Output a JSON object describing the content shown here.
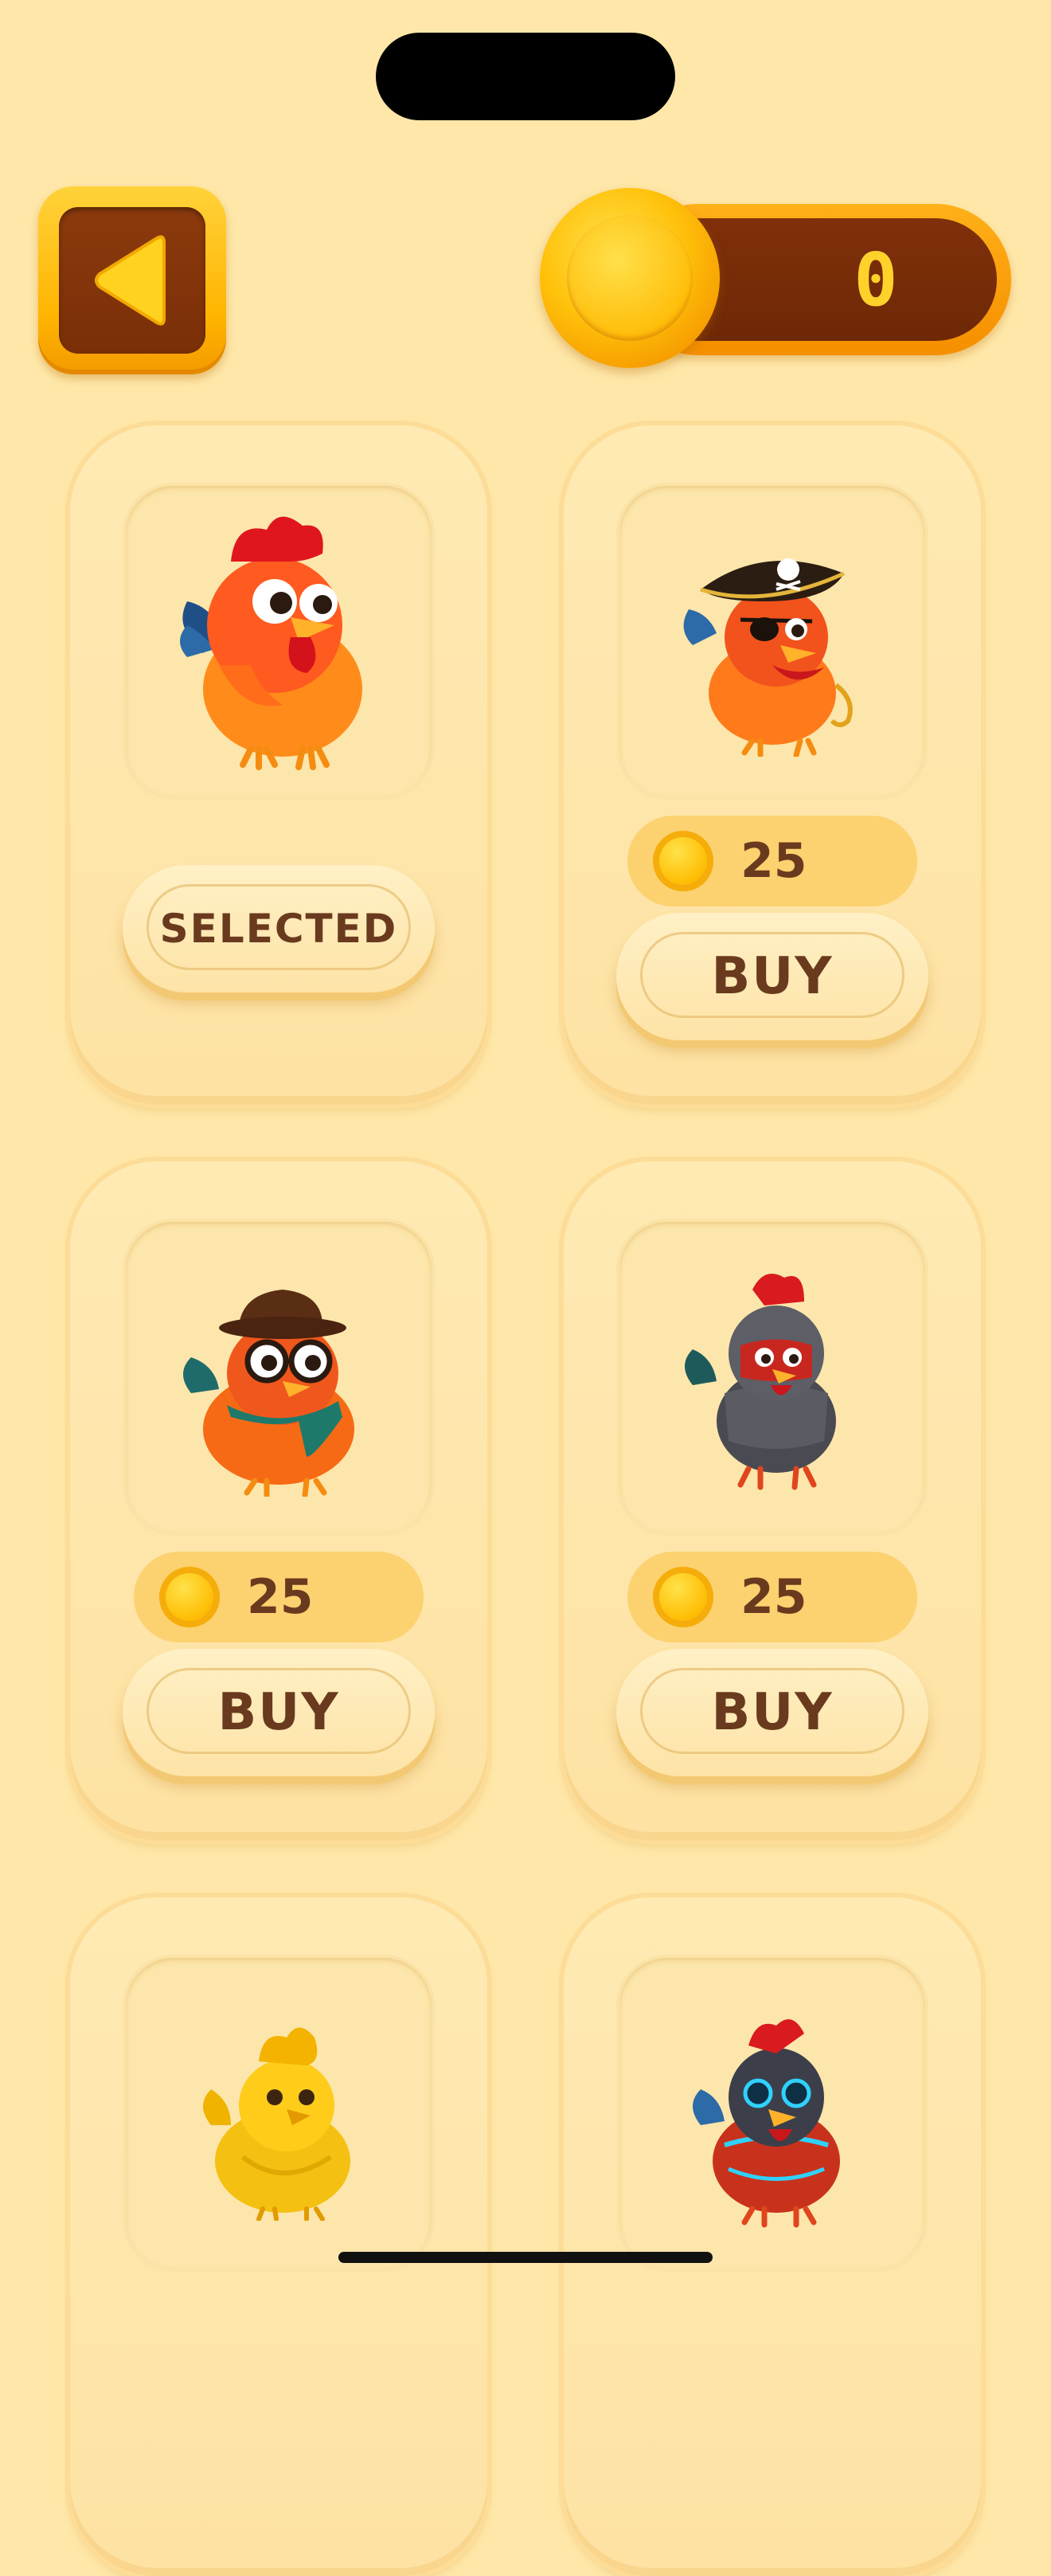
{
  "currency": {
    "balance": "0"
  },
  "shop": {
    "items": [
      {
        "name": "classic-chicken",
        "button": "SELECTED"
      },
      {
        "name": "pirate-chicken",
        "price": "25",
        "button": "BUY"
      },
      {
        "name": "professor-chicken",
        "price": "25",
        "button": "BUY"
      },
      {
        "name": "knight-chicken",
        "price": "25",
        "button": "BUY"
      },
      {
        "name": "golden-chicken"
      },
      {
        "name": "robot-chicken"
      }
    ]
  },
  "icons": {
    "back": "back-triangle-icon",
    "coin": "coin-icon"
  },
  "colors": {
    "background": "#fee7a8",
    "accent": "#ffb400",
    "text": "#6a3a1e",
    "coin": "#ffc10a"
  }
}
